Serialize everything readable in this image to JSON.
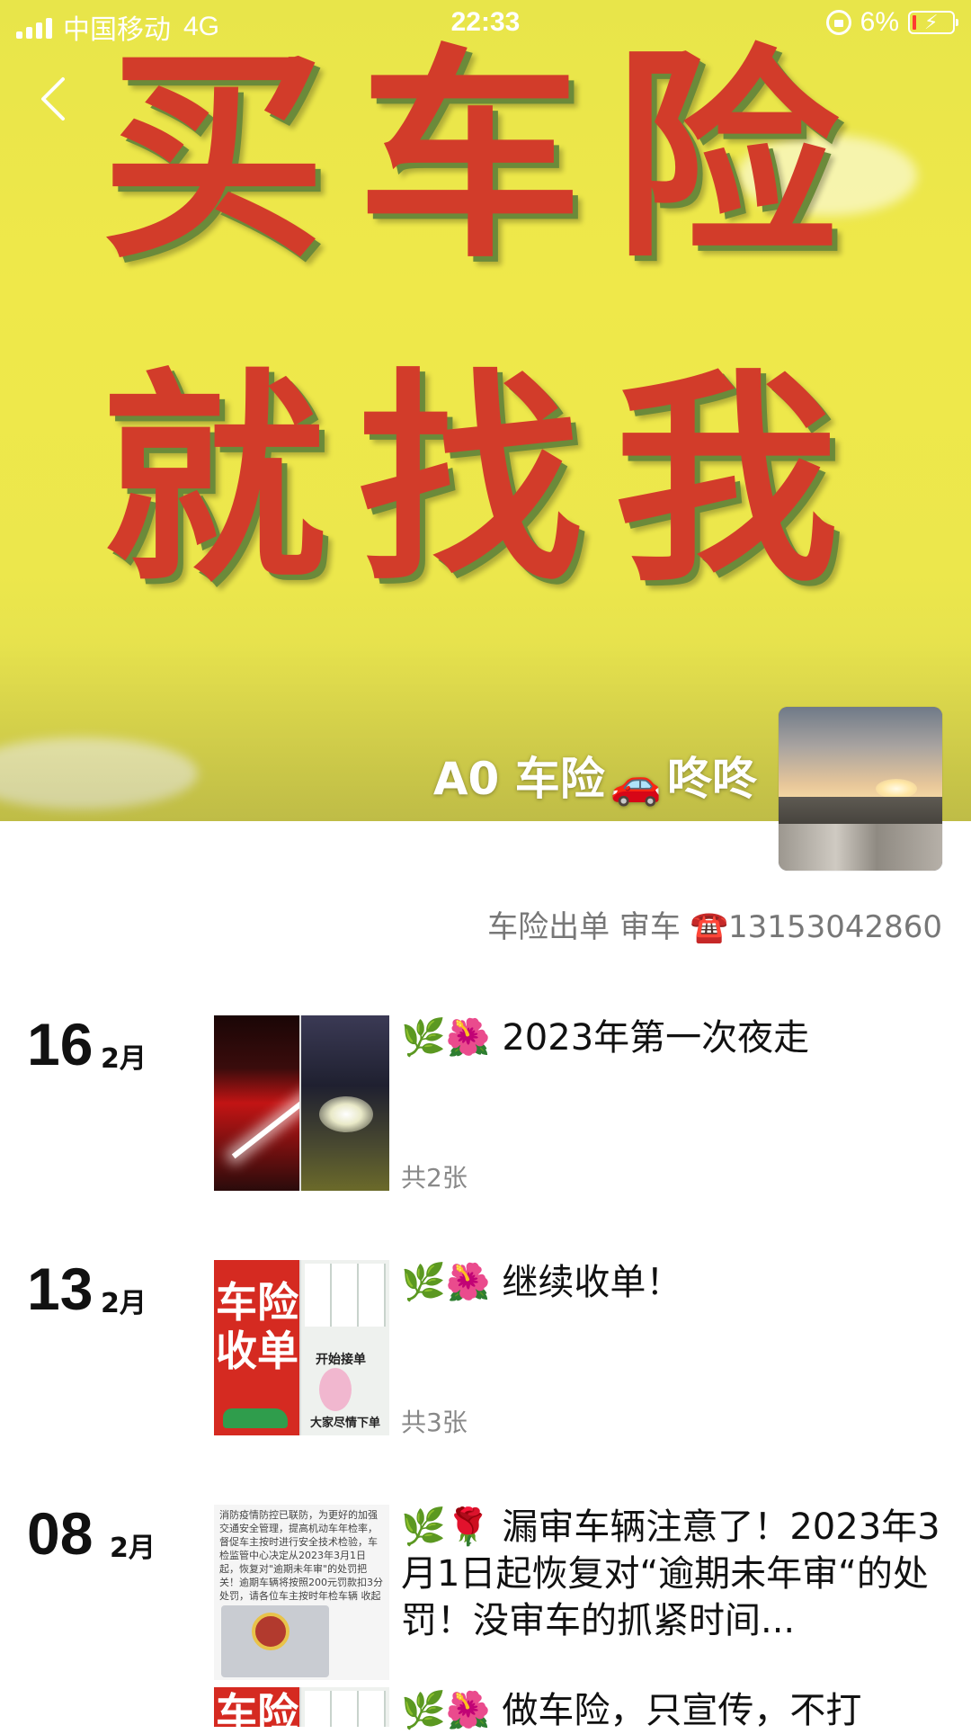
{
  "status_bar": {
    "carrier": "中国移动",
    "network": "4G",
    "time": "22:33",
    "battery": "6%",
    "icons": [
      "signal-icon",
      "orientation-lock-icon",
      "battery-charging-icon"
    ]
  },
  "cover": {
    "line1": "买车险",
    "line2": "就找我",
    "colors": {
      "background": "#ece74c",
      "text": "#d23c2a"
    }
  },
  "profile": {
    "name_prefix": "A0 车险",
    "name_emoji": "🚗",
    "name_suffix": "咚咚",
    "signature": "车险出单 审车 ☎️13153042860"
  },
  "posts": [
    {
      "day": "16",
      "month": "2月",
      "leaf": "🌿",
      "flower": "🌺",
      "text": "2023年第一次夜走",
      "count": "共2张"
    },
    {
      "day": "13",
      "month": "2月",
      "leaf": "🌿",
      "flower": "🌺",
      "text": "继续收单！",
      "count": "共3张",
      "thumb_left_text": "车险收单",
      "thumb_right_label1": "开始接单",
      "thumb_right_label2": "大家尽情下单"
    },
    {
      "day": "08",
      "month": "2月",
      "leaf": "🌿",
      "flower": "🌹",
      "text": "漏审车辆注意了！2023年3月1日起恢复对“逾期未年审“的处罚！没审车的抓紧时间...",
      "thumb_text": "消防疫情防控已联防，为更好的加强交通安全管理，提高机动车年检率，督促车主按时进行安全技术检验，车检监管中心决定从2023年3月1日起，恢复对\"逾期未年审\"的处罚把关！逾期车辆将按照200元罚款扣3分处罚，请各位车主按时年检车辆 收起"
    },
    {
      "leaf": "🌿",
      "flower": "🌺",
      "text": "做车险，只宣传，不打",
      "thumb_left_text": "车险"
    }
  ]
}
